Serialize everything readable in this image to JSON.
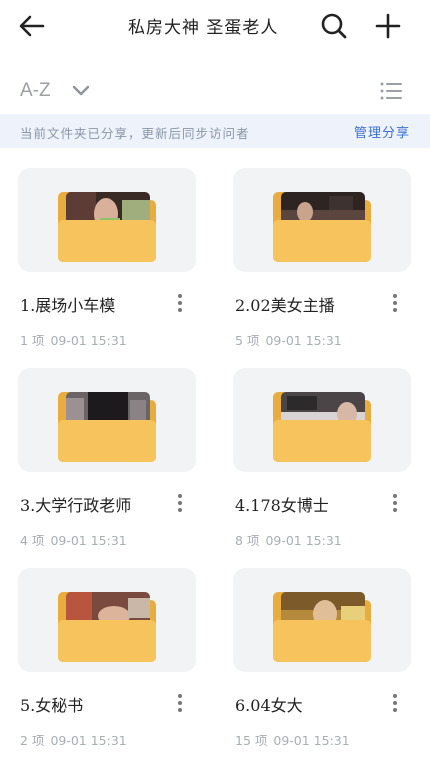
{
  "header": {
    "title": "私房大神 圣蛋老人",
    "icons": {
      "back": "arrow-left-icon",
      "search": "search-icon",
      "add": "plus-icon"
    }
  },
  "sort": {
    "label": "A-Z",
    "icons": {
      "dropdown": "chevron-down-icon",
      "view": "list-view-icon"
    }
  },
  "share": {
    "note": "当前文件夹已分享，更新后同步访问者",
    "manage_label": "管理分享",
    "accent_color": "#3a6fd8"
  },
  "folders": [
    {
      "name": "1.展场小车模",
      "count": "1 项",
      "date": "09-01 15:31"
    },
    {
      "name": "2.02美女主播",
      "count": "5 项",
      "date": "09-01 15:31"
    },
    {
      "name": "3.大学行政老师",
      "count": "4 项",
      "date": "09-01 15:31"
    },
    {
      "name": "4.178女博士",
      "count": "8 项",
      "date": "09-01 15:31"
    },
    {
      "name": "5.女秘书",
      "count": "2 项",
      "date": "09-01 15:31"
    },
    {
      "name": "6.04女大",
      "count": "15 项",
      "date": "09-01 15:31"
    }
  ],
  "colors": {
    "folder": "#f7c35c",
    "folder_dark": "#e9ac3e",
    "thumb_bg": "#f2f3f5"
  }
}
